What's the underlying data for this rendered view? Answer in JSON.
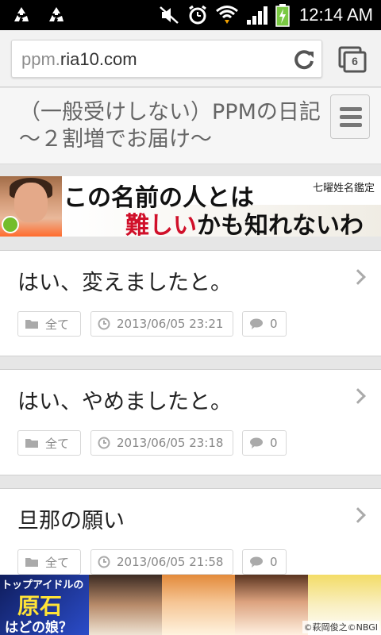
{
  "status_bar": {
    "time": "12:14 AM",
    "icons": [
      "recycle-icon",
      "recycle-icon",
      "mute-icon",
      "alarm-icon",
      "wifi-icon",
      "signal-icon",
      "battery-charging-icon"
    ]
  },
  "browser": {
    "url_dim": "ppm.",
    "url_main": "ria10.com",
    "tab_count": "6"
  },
  "site": {
    "title": "（一般受けしない）PPMの日記～２割増でお届け～"
  },
  "ad_banner": {
    "line1": "この名前の人とは",
    "tag": "七曜姓名鑑定",
    "line2_red": "難しい",
    "line2_black": "かも知れないわ"
  },
  "posts": [
    {
      "title": "はい、変えましたと。",
      "category": "全て",
      "date": "2013/06/05 23:21",
      "comments": "0"
    },
    {
      "title": "はい、やめましたと。",
      "category": "全て",
      "date": "2013/06/05 23:18",
      "comments": "0"
    },
    {
      "title": "旦那の願い",
      "category": "全て",
      "date": "2013/06/05 21:58",
      "comments": "0"
    }
  ],
  "bottom_ad": {
    "line1": "トップアイドルの",
    "line2": "原石",
    "line3": "はどの娘？",
    "copyright": "©萩岡俊之©NBGI"
  },
  "colors": {
    "status_bar_bg": "#000000",
    "page_bg": "#e6e6e6",
    "ad_red": "#d0102a"
  }
}
